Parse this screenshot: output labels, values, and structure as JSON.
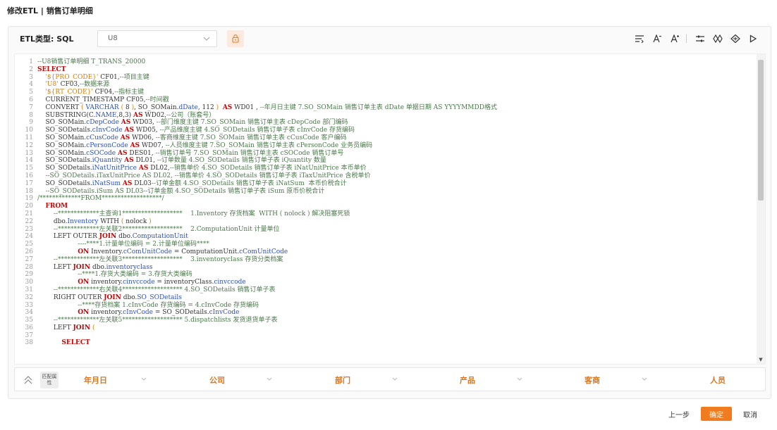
{
  "page": {
    "title": "修改ETL | 销售订单明细"
  },
  "toolbar": {
    "etl_type_label": "ETL类型: SQL",
    "datasource_value": "U8",
    "tools": [
      "format-icon",
      "font-decrease-icon",
      "font-increase-icon",
      "filter-settings-icon",
      "link-icon",
      "move-icon",
      "run-icon"
    ]
  },
  "code_lines": [
    {
      "n": "1",
      "html": "<span class='cm'>--U8销售订单明细 T_TRANS_20000</span>"
    },
    {
      "n": "2",
      "html": "<span class='kw'>SELECT</span>"
    },
    {
      "n": "3",
      "html": "    <span class='str'>'${PRO_CODE}'</span> CF01,<span class='cm'>--项目主键</span>"
    },
    {
      "n": "4",
      "html": "    <span class='str'>'U8'</span> CF03,<span class='cm'>--数据来源</span>"
    },
    {
      "n": "5",
      "html": "    <span class='str'>'${RT_CODE}'</span> CF04,<span class='cm'>--指标主键</span>"
    },
    {
      "n": "6",
      "html": "    CURRENT_TIMESTAMP CF05,<span class='cm'>--时间戳</span>"
    },
    {
      "n": "7",
      "html": "    CONVERT <span class='paren'>(</span> <span class='fn'>VARCHAR</span> <span class='paren'>(</span> 8 <span class='paren'>)</span>, SO_SOMain.<span class='fn'>dDate</span>, 112 <span class='paren'>)</span>  <span class='kw'>AS</span> WD01 , <span class='cm'>--年月日主键 7.SO_SOMain 销售订单主表 dDate 单据日期 AS YYYYMMDD格式</span>"
    },
    {
      "n": "8",
      "html": "    SUBSTRING(C.<span class='fn'>NAME</span>,8,3) <span class='kw'>AS</span> WD02,<span class='cm'>--公司（账套号）</span>"
    },
    {
      "n": "9",
      "html": "    SO_SOMain.<span class='fn'>cDepCode</span> <span class='kw'>AS</span> WD03, <span class='cm'>--部门维度主键 7.SO_SOMain 销售订单主表 cDepCode 部门编码</span>"
    },
    {
      "n": "10",
      "html": "    SO_SODetails.<span class='fn'>cInvCode</span> <span class='kw'>AS</span> WD05, <span class='cm'>--产品维度主键 4.SO_SODetails 销售订单子表 cInvCode 存货编码</span>"
    },
    {
      "n": "11",
      "html": "    SO_SOMain.<span class='fn'>cCusCode</span> <span class='kw'>AS</span> WD06, <span class='cm'>--客商维度主键 7.SO_SOMain 销售订单主表 cCusCode 客户编码</span>"
    },
    {
      "n": "12",
      "html": "    SO_SOMain.<span class='fn'>cPersonCode</span> <span class='kw'>AS</span> WD07, <span class='cm'>--人员维度主键 7.SO_SOMain 销售订单主表 cPersonCode 业务员编码</span>"
    },
    {
      "n": "13",
      "html": "    SO_SOMain.<span class='fn'>cSOCode</span> <span class='kw'>AS</span> DES01, <span class='cm'>--销售订单号 7.SO_SOMain 销售订单主表 cSOCode 销售订单号</span>"
    },
    {
      "n": "14",
      "html": "    SO_SODetails.<span class='fn'>iQuantity</span> <span class='kw'>AS</span> DL01, <span class='cm'>--订单数量 4.SO_SODetails 销售订单子表 iQuantity 数量</span>"
    },
    {
      "n": "15",
      "html": "    SO_SODetails.<span class='fn'>iNatUnitPrice</span> <span class='kw'>AS</span> DL02,<span class='cm'>--销售单价 4.SO_SODetails 销售订单子表 iNatUnitPrice 本币单价</span>"
    },
    {
      "n": "16",
      "html": "    <span class='cm'>--SO_SODetails.iTaxUnitPrice AS DL02, --销售单价 4.SO_SODetails 销售订单子表 iTaxUnitPrice 含税单价</span>"
    },
    {
      "n": "17",
      "html": "    SO_SODetails.<span class='fn'>iNatSum</span> <span class='kw'>AS</span> DL03<span class='cm'>--订单金额 4.SO_SODetails 销售订单子表 iNatSum  本币价税合计</span>"
    },
    {
      "n": "18",
      "html": "    <span class='cm'>--SO_SODetails.iSum AS DL03--订单金额 4.SO_SODetails 销售订单子表 iSum 原币价税合计</span>"
    },
    {
      "n": "19",
      "html": "<span class='cm'>/*************FROM*******************/</span>"
    },
    {
      "n": "20",
      "html": "    <span class='kw'>FROM</span>"
    },
    {
      "n": "21",
      "html": "        <span class='cm'>--*************主查询1*******************    1.Inventory 存货档案  WITH ( nolock ) 解决阻塞死锁</span>"
    },
    {
      "n": "22",
      "html": "        dbo.<span class='fn'>Inventory</span> WITH <span class='paren'>(</span> nolock <span class='paren'>)</span>"
    },
    {
      "n": "23",
      "html": "        <span class='cm'>--*************左关联2*******************    2.ComputationUnit 计量单位</span>"
    },
    {
      "n": "24",
      "html": "        LEFT OUTER <span class='kw'>JOIN</span> dbo.<span class='fn'>ComputationUnit</span>"
    },
    {
      "n": "25",
      "html": "                    <span class='cm'>----****1.计量单位编码 = 2.计量单位编码****</span>"
    },
    {
      "n": "26",
      "html": "                    <span class='kw'>ON</span> Inventory.<span class='fn'>cComUnitCode</span> = ComputationUnit.<span class='fn'>cComUnitCode</span>"
    },
    {
      "n": "27",
      "html": "        <span class='cm'>--*************左关联3*******************    3.inventoryclass 存货分类档案</span>"
    },
    {
      "n": "28",
      "html": "        LEFT <span class='kw'>JOIN</span> dbo.<span class='fn'>inventoryclass</span>"
    },
    {
      "n": "29",
      "html": "                    <span class='cm'>--****1.存货大类编码 = 3.存货大类编码</span>"
    },
    {
      "n": "30",
      "html": "                    <span class='kw'>ON</span> inventory.<span class='fn'>cinvccode</span> = inventoryClass.<span class='fn'>cinvccode</span>"
    },
    {
      "n": "31",
      "html": "        <span class='cm'>--*************右关联4******************* 4.SO_SODetails 销售订单子表</span>"
    },
    {
      "n": "32",
      "html": "        RIGHT OUTER <span class='kw'>JOIN</span> dbo.<span class='fn'>SO_SODetails</span>"
    },
    {
      "n": "33",
      "html": "                    <span class='cm'>--****存货档案 1.cInvCode 存货编码 = 4.cInvCode 存货编码</span>"
    },
    {
      "n": "34",
      "html": "                    <span class='kw'>ON</span> inventory.<span class='fn'>cInvCode</span> = SO_SODetails.<span class='fn'>cInvCode</span>"
    },
    {
      "n": "35",
      "html": "        <span class='cm'>--*************左关联5******************* 5.dispatchlists 发货退货单子表</span>"
    },
    {
      "n": "36",
      "html": "        LEFT <span class='kw'>JOIN</span> <span class='paren'>(</span>"
    },
    {
      "n": "37",
      "html": ""
    },
    {
      "n": "38",
      "html": "            <span class='kw'>SELECT</span>"
    }
  ],
  "match_bar": {
    "badge": "匹配属性",
    "dimensions": [
      "年月日",
      "公司",
      "部门",
      "产品",
      "客商",
      "人员"
    ]
  },
  "footer": {
    "prev_label": "上一步",
    "confirm_label": "确定",
    "cancel_label": "取消"
  }
}
